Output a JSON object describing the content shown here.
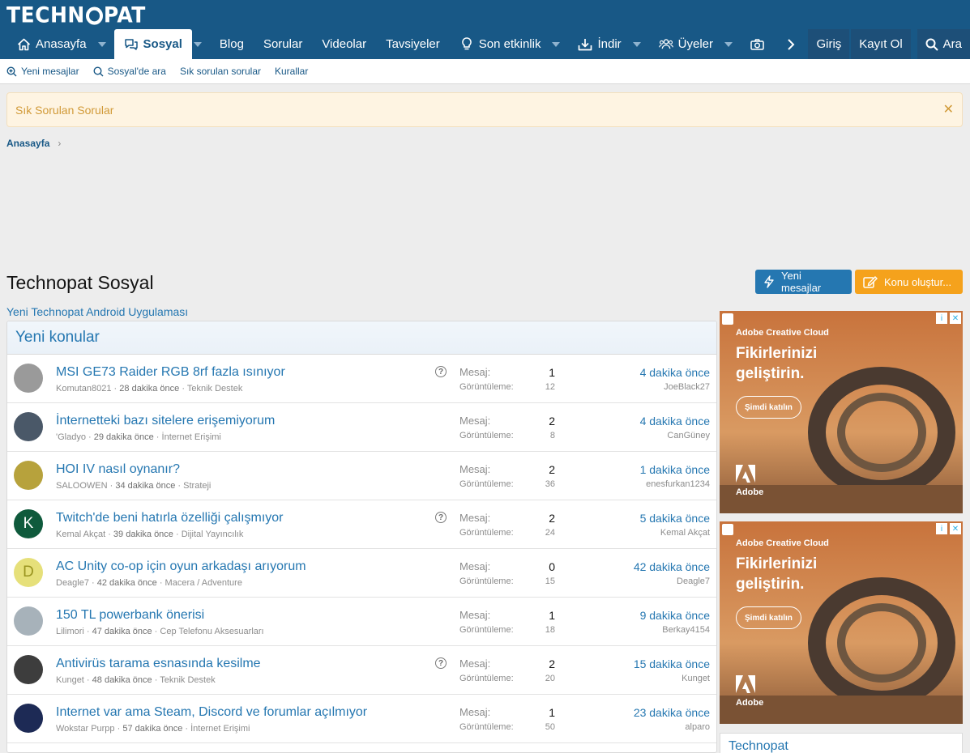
{
  "header": {
    "logo": "TECHNOPAT",
    "nav": [
      {
        "label": "Anasayfa",
        "icon": "home-icon",
        "caret": true,
        "active": false
      },
      {
        "label": "Sosyal",
        "icon": "chat-icon",
        "caret": true,
        "active": true
      },
      {
        "label": "Blog",
        "icon": "",
        "caret": false,
        "active": false
      },
      {
        "label": "Sorular",
        "icon": "",
        "caret": false,
        "active": false
      },
      {
        "label": "Videolar",
        "icon": "",
        "caret": false,
        "active": false
      },
      {
        "label": "Tavsiyeler",
        "icon": "",
        "caret": false,
        "active": false
      },
      {
        "label": "Son etkinlik",
        "icon": "lightbulb-icon",
        "caret": true,
        "active": false
      },
      {
        "label": "İndir",
        "icon": "download-icon",
        "caret": true,
        "active": false
      },
      {
        "label": "Üyeler",
        "icon": "users-icon",
        "caret": true,
        "active": false
      }
    ],
    "login": "Giriş",
    "register": "Kayıt Ol",
    "search": "Ara"
  },
  "subnav": {
    "items": [
      "Yeni mesajlar",
      "Sosyal'de ara",
      "Sık sorulan sorular",
      "Kurallar"
    ]
  },
  "notice": {
    "text": "Sık Sorulan Sorular"
  },
  "breadcrumb": {
    "home": "Anasayfa"
  },
  "page": {
    "title": "Technopat Sosyal",
    "new_posts_button": "Yeni mesajlar",
    "create_thread_button": "Konu oluştur...",
    "app_link": "Yeni Technopat Android Uygulaması"
  },
  "threads": {
    "heading": "Yeni konular",
    "label_replies": "Mesaj:",
    "label_views": "Görüntüleme:",
    "rows": [
      {
        "title": "MSI GE73 Raider RGB 8rf fazla ısınıyor",
        "author": "Komutan8021",
        "time": "28 dakika önce",
        "forum": "Teknik Destek",
        "question": true,
        "replies": "1",
        "views": "12",
        "last_time": "4 dakika önce",
        "last_user": "JoeBlack27",
        "avatar_letter": "",
        "avatar_color": "#9a9a9a"
      },
      {
        "title": "İnternetteki bazı sitelere erişemiyorum",
        "author": "'Gladyo",
        "time": "29 dakika önce",
        "forum": "İnternet Erişimi",
        "question": false,
        "replies": "2",
        "views": "8",
        "last_time": "4 dakika önce",
        "last_user": "CanGüney",
        "avatar_letter": "",
        "avatar_color": "#4a5868"
      },
      {
        "title": "HOI IV nasıl oynanır?",
        "author": "SALOOWEN",
        "time": "34 dakika önce",
        "forum": "Strateji",
        "question": false,
        "replies": "2",
        "views": "36",
        "last_time": "1 dakika önce",
        "last_user": "enesfurkan1234",
        "avatar_letter": "",
        "avatar_color": "#b7a23c"
      },
      {
        "title": "Twitch'de beni hatırla özelliği çalışmıyor",
        "author": "Kemal Akçat",
        "time": "39 dakika önce",
        "forum": "Dijital Yayıncılık",
        "question": true,
        "replies": "2",
        "views": "24",
        "last_time": "5 dakika önce",
        "last_user": "Kemal Akçat",
        "avatar_letter": "K",
        "avatar_color": "#0f5a3c"
      },
      {
        "title": "AC Unity co-op için oyun arkadaşı arıyorum",
        "author": "Deagle7",
        "time": "42 dakika önce",
        "forum": "Macera / Adventure",
        "question": false,
        "replies": "0",
        "views": "15",
        "last_time": "42 dakika önce",
        "last_user": "Deagle7",
        "avatar_letter": "D",
        "avatar_color": "#e6e07a"
      },
      {
        "title": "150 TL powerbank önerisi",
        "author": "Lilimori",
        "time": "47 dakika önce",
        "forum": "Cep Telefonu Aksesuarları",
        "question": false,
        "replies": "1",
        "views": "18",
        "last_time": "9 dakika önce",
        "last_user": "Berkay4154",
        "avatar_letter": "",
        "avatar_color": "#a7b2ba"
      },
      {
        "title": "Antivirüs tarama esnasında kesilme",
        "author": "Kunget",
        "time": "48 dakika önce",
        "forum": "Teknik Destek",
        "question": true,
        "replies": "2",
        "views": "20",
        "last_time": "15 dakika önce",
        "last_user": "Kunget",
        "avatar_letter": "",
        "avatar_color": "#3d3d3d"
      },
      {
        "title": "Internet var ama Steam, Discord ve forumlar açılmıyor",
        "author": "Wokstar Purpp",
        "time": "57 dakika önce",
        "forum": "İnternet Erişimi",
        "question": false,
        "replies": "1",
        "views": "50",
        "last_time": "23 dakika önce",
        "last_user": "alparo",
        "avatar_letter": "",
        "avatar_color": "#1d2a55"
      }
    ]
  },
  "ads": {
    "brand": "Adobe Creative Cloud",
    "headline": "Fikirlerinizi geliştirin.",
    "cta": "Şimdi katılın",
    "logo_text": "Adobe"
  },
  "sidebar": {
    "block_title": "Technopat"
  }
}
